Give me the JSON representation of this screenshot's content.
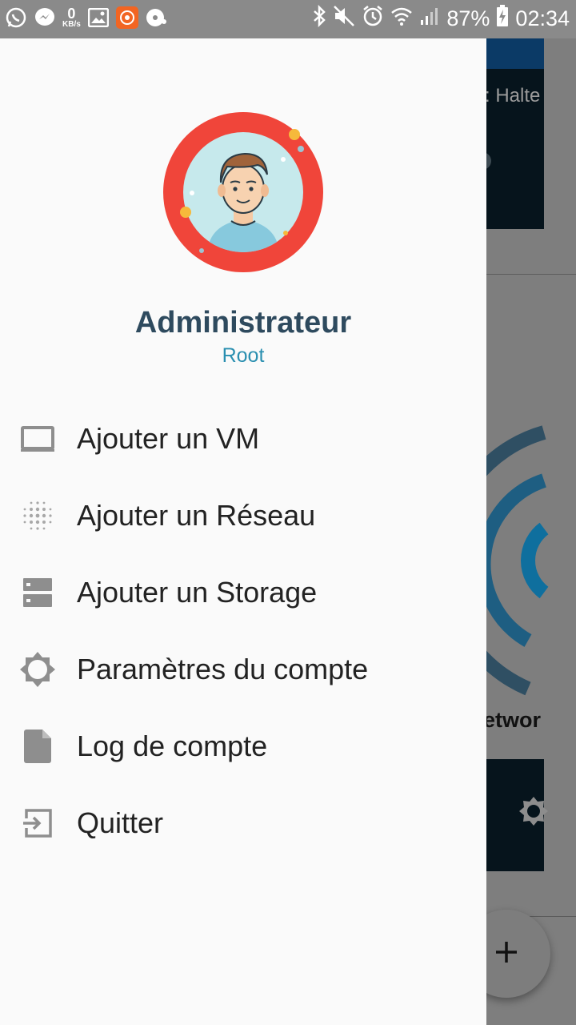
{
  "status_bar": {
    "net_speed_value": "0",
    "net_speed_unit": "KB/s",
    "battery": "87%",
    "time": "02:34"
  },
  "drawer": {
    "user": {
      "name": "Administrateur",
      "role": "Root"
    },
    "menu": [
      {
        "label": "Ajouter un VM",
        "icon": "laptop-icon"
      },
      {
        "label": "Ajouter un Réseau",
        "icon": "dots-grid-icon"
      },
      {
        "label": "Ajouter un Storage",
        "icon": "storage-icon"
      },
      {
        "label": "Paramètres du compte",
        "icon": "settings-icon"
      },
      {
        "label": "Log de compte",
        "icon": "file-icon"
      },
      {
        "label": "Quitter",
        "icon": "exit-icon"
      }
    ]
  },
  "background": {
    "status_text": ": Halte",
    "section_title": "etwor",
    "fab_label": "+"
  },
  "colors": {
    "avatar_ring": "#f0453a",
    "name": "#2e4a5e",
    "role": "#2a8fb0",
    "icon": "#8e8e8e"
  }
}
